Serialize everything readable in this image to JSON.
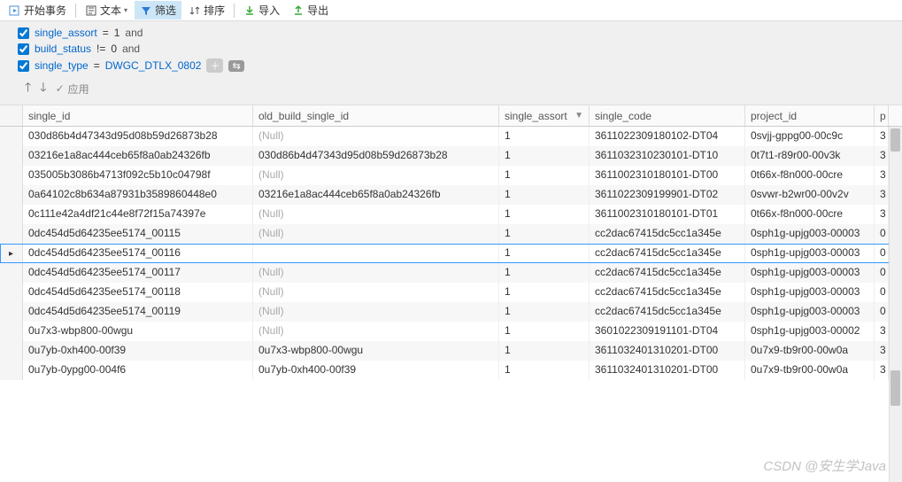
{
  "toolbar": {
    "begin_tx": "开始事务",
    "text": "文本",
    "filter": "筛选",
    "sort": "排序",
    "import": "导入",
    "export": "导出"
  },
  "filter": {
    "rows": [
      {
        "field": "single_assort",
        "op": "=",
        "val": "1",
        "and": "and",
        "checked": true
      },
      {
        "field": "build_status",
        "op": "!=",
        "val": "0",
        "and": "and",
        "checked": true
      },
      {
        "field": "single_type",
        "op": "=",
        "val": "DWGC_DTLX_0802",
        "and": "",
        "checked": true,
        "val_link": true,
        "extras": true
      }
    ],
    "apply": "应用"
  },
  "columns": {
    "single_id": "single_id",
    "old": "old_build_single_id",
    "assort": "single_assort",
    "code": "single_code",
    "project": "project_id",
    "p": "p"
  },
  "rows": [
    {
      "single_id": "030d86b4d47343d95d08b59d26873b28",
      "old": "(Null)",
      "old_null": true,
      "assort": "1",
      "code": "3611022309180102-DT04",
      "project": "0svjj-gppg00-00c9c",
      "p": "3"
    },
    {
      "single_id": "03216e1a8ac444ceb65f8a0ab24326fb",
      "old": "030d86b4d47343d95d08b59d26873b28",
      "old_null": false,
      "assort": "1",
      "code": "3611032310230101-DT10",
      "project": "0t7t1-r89r00-00v3k",
      "p": "3"
    },
    {
      "single_id": "035005b3086b4713f092c5b10c04798f",
      "old": "(Null)",
      "old_null": true,
      "assort": "1",
      "code": "3611002310180101-DT00",
      "project": "0t66x-f8n000-00cre",
      "p": "3"
    },
    {
      "single_id": "0a64102c8b634a87931b3589860448e0",
      "old": "03216e1a8ac444ceb65f8a0ab24326fb",
      "old_null": false,
      "assort": "1",
      "code": "3611022309199901-DT02",
      "project": "0svwr-b2wr00-00v2v",
      "p": "3"
    },
    {
      "single_id": "0c111e42a4df21c44e8f72f15a74397e",
      "old": "(Null)",
      "old_null": true,
      "assort": "1",
      "code": "3611002310180101-DT01",
      "project": "0t66x-f8n000-00cre",
      "p": "3"
    },
    {
      "single_id": "0dc454d5d64235ee5174_00115",
      "old": "(Null)",
      "old_null": true,
      "assort": "1",
      "code": "cc2dac67415dc5cc1a345e",
      "project": "0sph1g-upjg003-00003",
      "p": "0"
    },
    {
      "single_id": "0dc454d5d64235ee5174_00116",
      "old": "",
      "old_null": false,
      "assort": "1",
      "code": "cc2dac67415dc5cc1a345e",
      "project": "0sph1g-upjg003-00003",
      "p": "0",
      "active": true
    },
    {
      "single_id": "0dc454d5d64235ee5174_00117",
      "old": "(Null)",
      "old_null": true,
      "assort": "1",
      "code": "cc2dac67415dc5cc1a345e",
      "project": "0sph1g-upjg003-00003",
      "p": "0"
    },
    {
      "single_id": "0dc454d5d64235ee5174_00118",
      "old": "(Null)",
      "old_null": true,
      "assort": "1",
      "code": "cc2dac67415dc5cc1a345e",
      "project": "0sph1g-upjg003-00003",
      "p": "0"
    },
    {
      "single_id": "0dc454d5d64235ee5174_00119",
      "old": "(Null)",
      "old_null": true,
      "assort": "1",
      "code": "cc2dac67415dc5cc1a345e",
      "project": "0sph1g-upjg003-00003",
      "p": "0"
    },
    {
      "single_id": "0u7x3-wbp800-00wgu",
      "old": "(Null)",
      "old_null": true,
      "assort": "1",
      "code": "3601022309191101-DT04",
      "project": "0sph1g-upjg003-00002",
      "p": "3"
    },
    {
      "single_id": "0u7yb-0xh400-00f39",
      "old": "0u7x3-wbp800-00wgu",
      "old_null": false,
      "assort": "1",
      "code": "3611032401310201-DT00",
      "project": "0u7x9-tb9r00-00w0a",
      "p": "3"
    },
    {
      "single_id": "0u7yb-0ypg00-004f6",
      "old": "0u7yb-0xh400-00f39",
      "old_null": false,
      "assort": "1",
      "code": "3611032401310201-DT00",
      "project": "0u7x9-tb9r00-00w0a",
      "p": "3"
    }
  ],
  "watermark": "CSDN @安生学Java"
}
